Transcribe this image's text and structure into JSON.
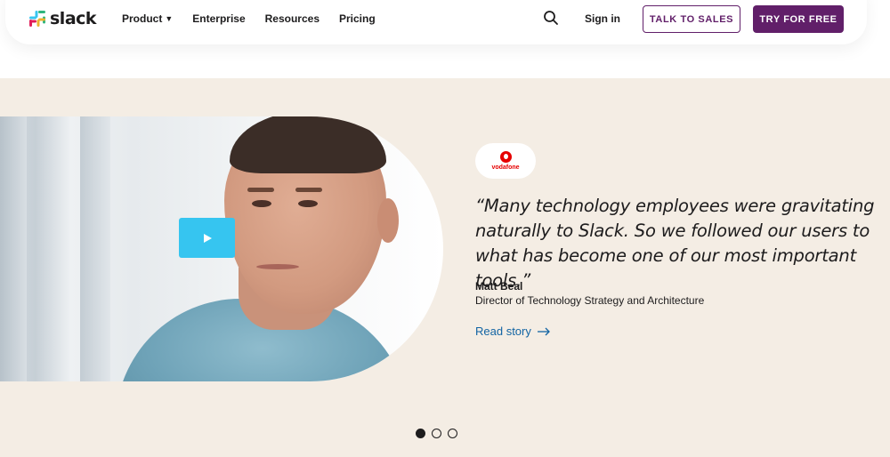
{
  "nav": {
    "logo_text": "slack",
    "links": [
      {
        "label": "Product",
        "has_dropdown": true
      },
      {
        "label": "Enterprise"
      },
      {
        "label": "Resources"
      },
      {
        "label": "Pricing"
      }
    ],
    "signin_label": "Sign in",
    "talk_to_sales_label": "TALK TO SALES",
    "try_free_label": "TRY FOR FREE"
  },
  "testimonial": {
    "brand_name": "vodafone",
    "quote": "“Many technology employees were gravitating naturally to Slack. So we followed our users to what has become one of our most important tools.”",
    "person_name": "Matt Beal",
    "person_role": "Director of Technology Strategy and Architecture",
    "read_story_label": "Read story",
    "carousel": {
      "total": 3,
      "active_index": 0
    }
  },
  "colors": {
    "brand_purple": "#611f69",
    "section_bg": "#f4ede4",
    "link_blue": "#1264a3",
    "play_button": "#36c5f0",
    "vodafone_red": "#e60000"
  },
  "icons": [
    "slack-logo-icon",
    "chevron-down-icon",
    "search-icon",
    "play-icon",
    "vodafone-logo-icon",
    "arrow-right-icon"
  ]
}
